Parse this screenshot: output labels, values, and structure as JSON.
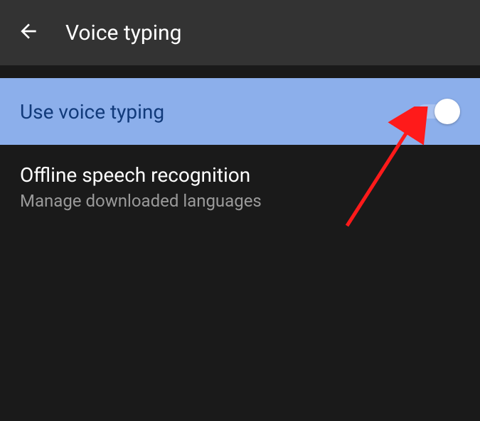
{
  "header": {
    "title": "Voice typing"
  },
  "settings": {
    "voice_typing": {
      "label": "Use voice typing",
      "enabled": true
    },
    "offline_speech": {
      "title": "Offline speech recognition",
      "subtitle": "Manage downloaded languages"
    }
  }
}
